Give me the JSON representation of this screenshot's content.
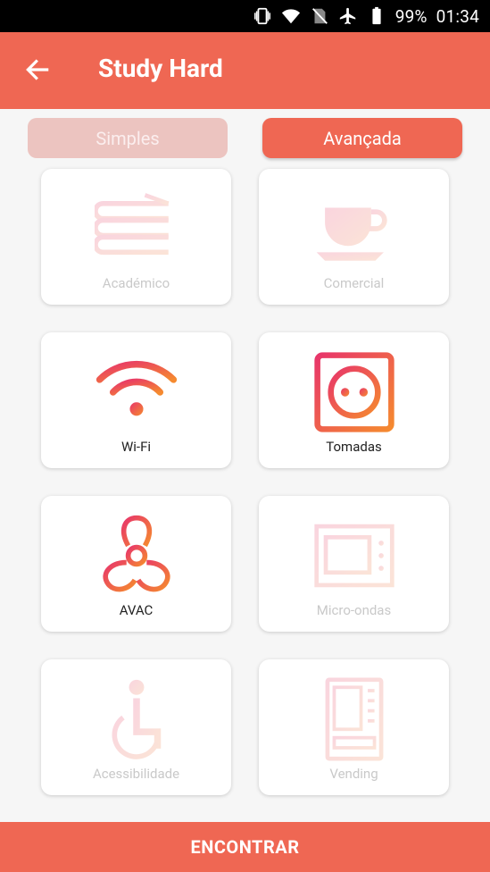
{
  "status_bar": {
    "battery": "99%",
    "time": "01:34",
    "icons": [
      "vibrate-icon",
      "wifi-icon",
      "no-sim-icon",
      "airplane-icon",
      "battery-icon"
    ]
  },
  "app_bar": {
    "title": "Study Hard",
    "back_icon": "arrow-left-icon"
  },
  "toggle": {
    "simple_label": "Simples",
    "advanced_label": "Avançada",
    "selected": "advanced"
  },
  "cards": [
    {
      "label": "Académico",
      "icon": "books-icon",
      "selected": false
    },
    {
      "label": "Comercial",
      "icon": "coffee-cup-icon",
      "selected": false
    },
    {
      "label": "Wi-Fi",
      "icon": "wifi-icon",
      "selected": true
    },
    {
      "label": "Tomadas",
      "icon": "power-socket-icon",
      "selected": true
    },
    {
      "label": "AVAC",
      "icon": "fan-icon",
      "selected": true
    },
    {
      "label": "Micro-ondas",
      "icon": "microwave-icon",
      "selected": false
    },
    {
      "label": "Acessibilidade",
      "icon": "wheelchair-icon",
      "selected": false
    },
    {
      "label": "Vending",
      "icon": "vending-machine-icon",
      "selected": false
    }
  ],
  "bottom_button": {
    "label": "ENCONTRAR"
  },
  "colors": {
    "accent": "#ef6753",
    "gradient_start": "#e8366a",
    "gradient_end": "#f58a2f"
  }
}
